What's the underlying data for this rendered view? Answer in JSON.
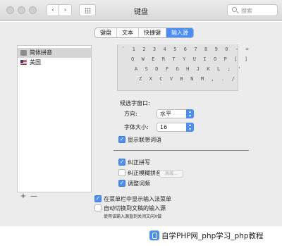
{
  "window": {
    "title": "键盘",
    "search_placeholder": "搜索"
  },
  "tabs": [
    {
      "label": "键盘",
      "active": false
    },
    {
      "label": "文本",
      "active": false
    },
    {
      "label": "快捷键",
      "active": false
    },
    {
      "label": "输入源",
      "active": true
    }
  ],
  "input_sources": [
    {
      "label": "简体拼音",
      "icon": "pinyin-icon",
      "selected": true
    },
    {
      "label": "美国",
      "icon": "us-flag-icon",
      "selected": false
    }
  ],
  "list_controls": {
    "add": "+",
    "remove": "—"
  },
  "keyboard_rows": [
    "` 1 2 3 4 5 6 7 8 9 0 - =",
    "Q W E R T Y U I O P [ ]",
    "A S D F G H J K L ; '",
    "Z X C V B N M , . /"
  ],
  "settings": {
    "candidate_window_label": "候选字窗口:",
    "direction_label": "方向:",
    "direction_value": "水平",
    "font_size_label": "字体大小:",
    "font_size_value": "16",
    "show_predictive": {
      "label": "显示联想词语",
      "checked": true
    },
    "correct_spelling": {
      "label": "纠正拼写",
      "checked": true
    },
    "fuzzy_pinyin": {
      "label": "纠正模糊拼音",
      "checked": false
    },
    "advanced_button": "高级...",
    "adjust_frequency": {
      "label": "调整词频",
      "checked": true
    }
  },
  "bottom_options": {
    "show_in_menu_bar": {
      "label": "在菜单栏中显示输入法菜单",
      "checked": true
    },
    "auto_switch": {
      "label": "自动切换到文稿的输入源",
      "checked": false
    },
    "footnote": "使用该输入源直到关闭文闲X做"
  },
  "watermark": "自学PHP网_php学习_php教程",
  "colors": {
    "accent": "#4b8df6",
    "pane": "#ececec"
  }
}
